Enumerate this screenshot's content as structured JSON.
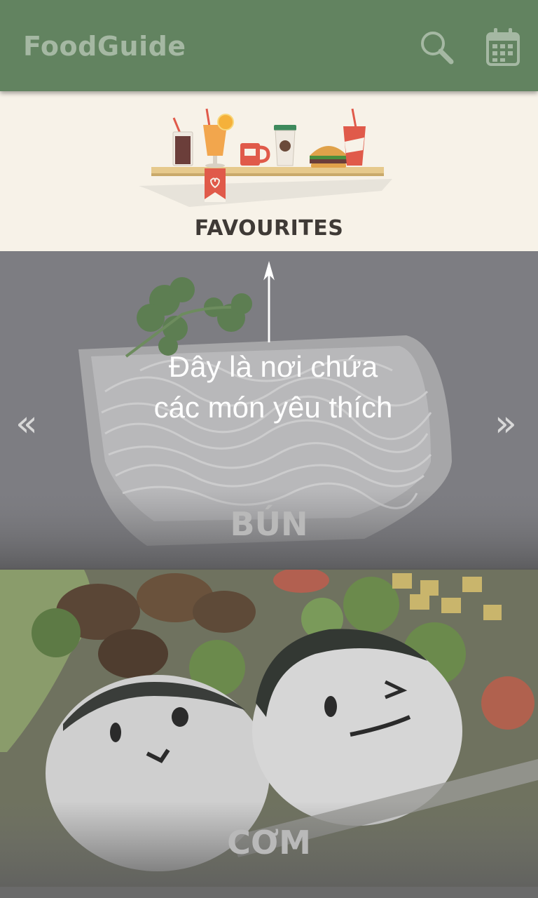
{
  "app_bar": {
    "title": "FoodGuide",
    "icons": {
      "search": "search-icon",
      "calendar": "calendar-icon"
    },
    "colors": {
      "background": "#628360",
      "icon": "#a5b8a3"
    }
  },
  "favourites": {
    "label": "FAVOURITES",
    "background": "#f7f2e8"
  },
  "categories": [
    {
      "label": "BÚN"
    },
    {
      "label": "CƠM"
    }
  ],
  "navigation": {
    "prev": "«",
    "next": "»"
  },
  "tutorial": {
    "line1": "Đây là nơi chứa",
    "line2": "các món yêu thích",
    "arrow": "arrow-up-icon"
  }
}
